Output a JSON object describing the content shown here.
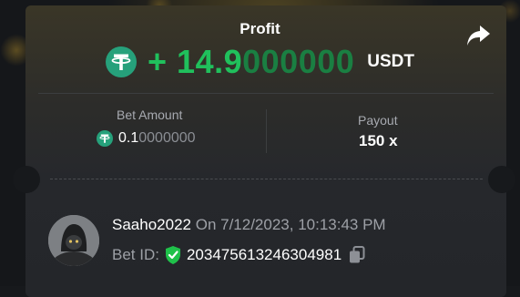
{
  "profit": {
    "title": "Profit",
    "sign": "+",
    "value_main": "14.9",
    "value_trailing": "000000",
    "currency": "USDT"
  },
  "bet": {
    "label": "Bet Amount",
    "value_main": "0.1",
    "value_trailing": "0000000"
  },
  "payout": {
    "label": "Payout",
    "value": "150 x"
  },
  "user": {
    "name": "Saaho2022",
    "timestamp": "On 7/12/2023, 10:13:43 PM"
  },
  "bet_id": {
    "label": "Bet ID:",
    "value": "203475613246304981"
  },
  "icons": {
    "coin": "tether-usdt-icon",
    "share": "share-arrow-icon",
    "verified": "verified-shield-icon",
    "copy": "copy-icon"
  },
  "colors": {
    "profit_green": "#20c05c",
    "tether_green": "#26a17b",
    "shield_green": "#1fc14a"
  }
}
